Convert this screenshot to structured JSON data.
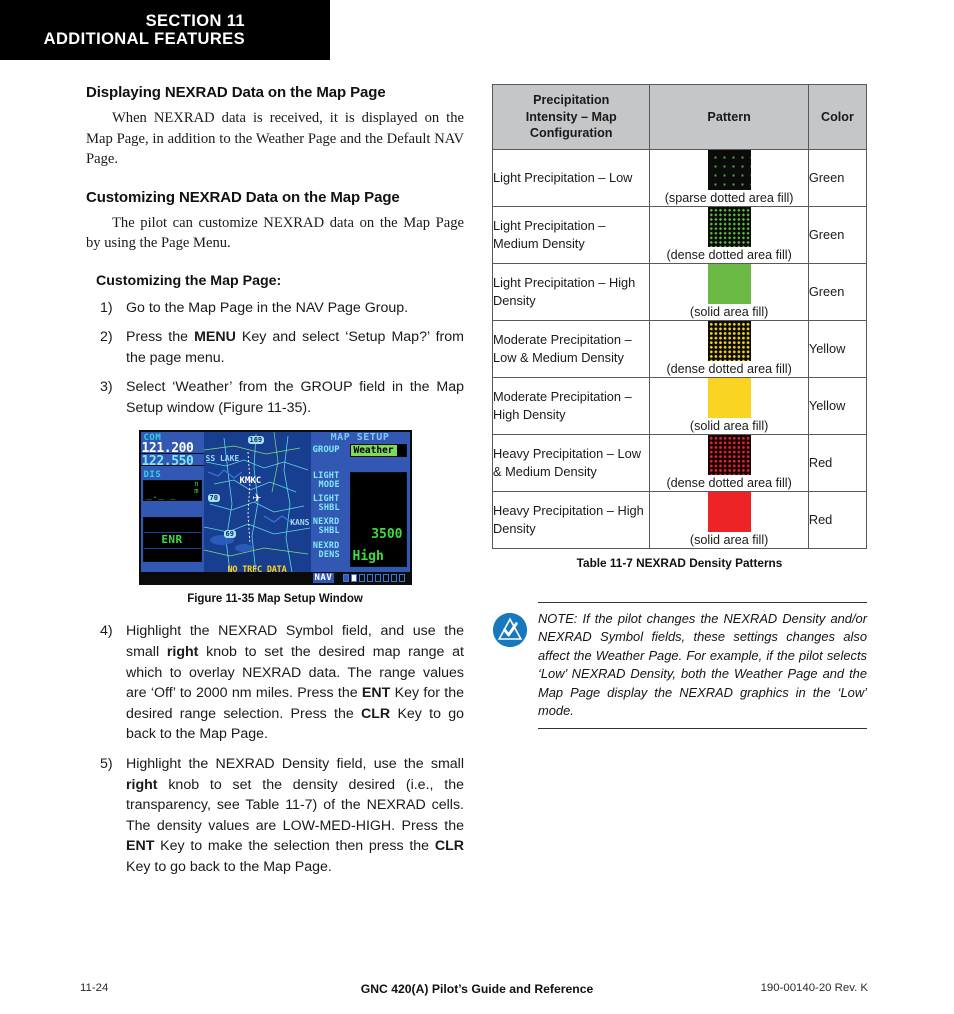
{
  "header": {
    "section": "SECTION 11",
    "subtitle": "ADDITIONAL FEATURES"
  },
  "left_column": {
    "heading_1": "Displaying NEXRAD Data on the Map Page",
    "paragraph_1": "When NEXRAD data is received, it is displayed on the Map Page, in addition to the Weather Page and the Default NAV Page.",
    "heading_2": "Customizing NEXRAD Data on the Map Page",
    "paragraph_2": "The pilot can customize NEXRAD data on the Map Page by using the Page Menu.",
    "procedure_heading": "Customizing the Map Page:",
    "steps": [
      {
        "number": "1)",
        "parts": [
          {
            "text": "Go to the Map Page in the NAV Page Group.",
            "bold": false
          }
        ]
      },
      {
        "number": "2)",
        "parts": [
          {
            "text": "Press the ",
            "bold": false
          },
          {
            "text": "MENU",
            "bold": true
          },
          {
            "text": " Key and select ‘Setup Map?’ from the page menu.",
            "bold": false
          }
        ]
      },
      {
        "number": "3)",
        "parts": [
          {
            "text": "Select ‘Weather’ from the GROUP field in the Map Setup window (Figure 11-35).",
            "bold": false
          }
        ]
      },
      {
        "number": "4)",
        "parts": [
          {
            "text": "Highlight the NEXRAD Symbol field, and use the small ",
            "bold": false
          },
          {
            "text": "right",
            "bold": true
          },
          {
            "text": " knob to set the desired map range at which to overlay NEXRAD data.  The range values are ‘Off’ to 2000 nm miles.  Press the ",
            "bold": false
          },
          {
            "text": "ENT",
            "bold": true
          },
          {
            "text": " Key for the desired range selection.  Press the ",
            "bold": false
          },
          {
            "text": "CLR",
            "bold": true
          },
          {
            "text": " Key to go back to the Map Page.",
            "bold": false
          }
        ]
      },
      {
        "number": "5)",
        "parts": [
          {
            "text": "Highlight the NEXRAD Density field, use the small ",
            "bold": false
          },
          {
            "text": "right",
            "bold": true
          },
          {
            "text": " knob to set the density desired (i.e., the transparency, see Table 11-7) of the NEXRAD cells.  The density values are LOW-MED-HIGH.  Press the ",
            "bold": false
          },
          {
            "text": "ENT",
            "bold": true
          },
          {
            "text": " Key to make the selection then press the ",
            "bold": false
          },
          {
            "text": "CLR",
            "bold": true
          },
          {
            "text": " Key to go back to the Map Page.",
            "bold": false
          }
        ]
      }
    ],
    "figure_caption": "Figure 11-35 Map Setup Window"
  },
  "gps_screen": {
    "com_label": "COM",
    "com_active_freq": "121.200",
    "com_standby_freq": "122.550",
    "dis_label": "DIS",
    "dis_units": "n m",
    "dis_value": "_._ _",
    "phase_label": "ENR",
    "map_airport": "KMKC",
    "map_city_left": "SS LAKE",
    "map_city_right": "KANS",
    "map_highway_1": "169",
    "map_highway_2": "70",
    "map_highway_3": "69",
    "map_warning": "NO TRFC DATA",
    "setup_title": "MAP SETUP",
    "group_label": "GROUP",
    "group_value": "Weather",
    "fields": [
      {
        "label_line1": "LIGHT",
        "label_line2": "MODE",
        "value": ""
      },
      {
        "label_line1": "LIGHT",
        "label_line2": "SHBL",
        "value": ""
      },
      {
        "label_line1": "NEXRD",
        "label_line2": "SHBL",
        "value": "3500"
      },
      {
        "label_line1": "NEXRD",
        "label_line2": "DENS",
        "value": "High"
      }
    ],
    "nav_label": "NAV"
  },
  "table": {
    "headers": [
      "Precipitation Intensity – Map Configuration",
      "Pattern",
      "Color"
    ],
    "header_lines": [
      [
        "Precipitation",
        "Intensity – Map",
        "Configuration"
      ],
      [
        "Pattern"
      ],
      [
        "Color"
      ]
    ],
    "rows": [
      {
        "label": "Light Precipitation – Low",
        "pattern_class": "dot-sparse-green",
        "pattern_note": "(sparse dotted area fill)",
        "color": "Green",
        "color_hex": "#6cba46"
      },
      {
        "label": "Light Precipitation – Medium Density",
        "pattern_class": "dot-dense-green",
        "pattern_note": "(dense dotted area fill)",
        "color": "Green",
        "color_hex": "#6cba46"
      },
      {
        "label": "Light Precipitation – High Density",
        "pattern_class": "solid-green",
        "pattern_note": "(solid area fill)",
        "color": "Green",
        "color_hex": "#6cba46"
      },
      {
        "label": "Moderate Precipitation – Low & Medium Density",
        "pattern_class": "dot-dense-yellow",
        "pattern_note": "(dense dotted area fill)",
        "color": "Yellow",
        "color_hex": "#f9d423"
      },
      {
        "label": "Moderate Precipitation – High Density",
        "pattern_class": "solid-yellow",
        "pattern_note": "(solid area fill)",
        "color": "Yellow",
        "color_hex": "#f9d423"
      },
      {
        "label": "Heavy Precipitation – Low & Medium Density",
        "pattern_class": "dot-dense-red",
        "pattern_note": "(dense dotted area fill)",
        "color": "Red",
        "color_hex": "#ee2326"
      },
      {
        "label": "Heavy Precipitation – High Density",
        "pattern_class": "solid-red",
        "pattern_note": "(solid area fill)",
        "color": "Red",
        "color_hex": "#ee2326"
      }
    ],
    "caption": "Table 11-7  NEXRAD Density Patterns"
  },
  "note": {
    "icon": "garmin-note-icon",
    "icon_color": "#1878be",
    "text": "NOTE:  If the pilot changes the NEXRAD Density and/or NEXRAD Symbol fields, these settings changes also affect the Weather Page.   For example, if the pilot selects ‘Low’ NEXRAD Density, both the Weather Page and the Map Page display the NEXRAD graphics in the ‘Low’ mode."
  },
  "footer": {
    "page_number": "11-24",
    "title": "GNC 420(A) Pilot’s Guide and Reference",
    "doc_number": "190-00140-20  Rev. K"
  }
}
